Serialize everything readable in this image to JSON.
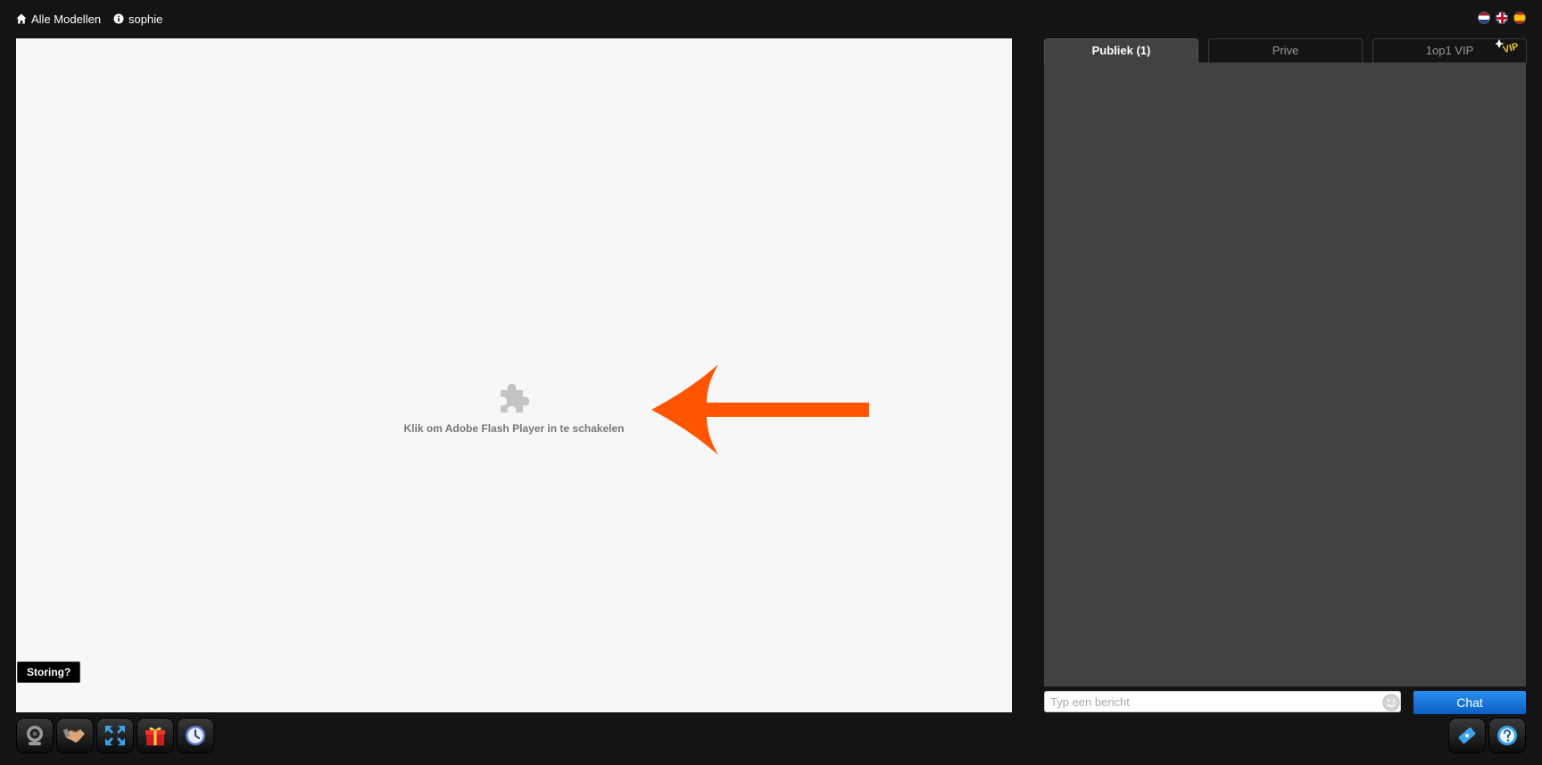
{
  "topnav": {
    "all_models": "Alle Modellen",
    "username": "sophie"
  },
  "player": {
    "flash_message": "Klik om Adobe Flash Player in te schakelen",
    "storing_label": "Storing?"
  },
  "chat": {
    "tabs": [
      {
        "label": "Publiek (1)",
        "active": true
      },
      {
        "label": "Prive",
        "active": false
      },
      {
        "label": "1op1 VIP",
        "active": false
      }
    ],
    "vip_badge": "VIP",
    "input_placeholder": "Typ een bericht",
    "send_label": "Chat"
  },
  "toolbar": {
    "left": [
      "webcam-icon",
      "handshake-icon",
      "fullscreen-icon",
      "gift-icon",
      "clock-icon"
    ],
    "right": [
      "ticket-icon",
      "help-icon"
    ]
  },
  "colors": {
    "accent_arrow": "#ff5500",
    "chat_button": "#0a6ad6",
    "chat_bg": "#424242",
    "player_bg": "#f7f7f7"
  }
}
